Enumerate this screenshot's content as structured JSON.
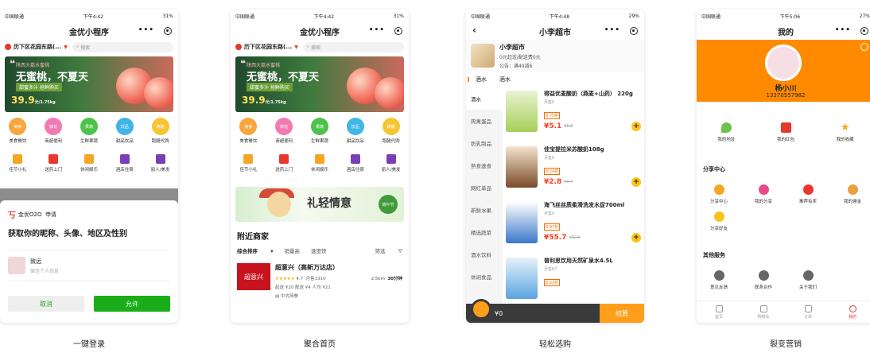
{
  "common": {
    "carrier": "中国联通",
    "app_title": "金优小程序",
    "location": "历下区花园东路(...",
    "search_placeholder": "搜索"
  },
  "phone1": {
    "time": "下午4:42",
    "battery": "31%",
    "banner": {
      "tag": "陕西大荔水蜜桃",
      "headline": "无蜜桃，不夏天",
      "sub": "甜蜜多汁 抢鲜购买",
      "price": "39.9",
      "unit": "元/1.75kg"
    },
    "categories": [
      {
        "label": "美食餐饮",
        "badge": "美食",
        "color": "#f8a63d"
      },
      {
        "label": "商超便利",
        "badge": "鲜花",
        "color": "#f27ab2"
      },
      {
        "label": "生鲜果蔬",
        "badge": "果蔬",
        "color": "#4cc24a"
      },
      {
        "label": "甜品饮品",
        "badge": "饮品",
        "color": "#3fb5e8"
      },
      {
        "label": "跑腿代购",
        "badge": "跑腿",
        "color": "#f7c531"
      },
      {
        "label": "佳节小礼",
        "color": "#f5a623"
      },
      {
        "label": "送药上门",
        "color": "#e8372c"
      },
      {
        "label": "休闲娱乐",
        "color": "#f5a623"
      },
      {
        "label": "酒店住宿",
        "color": "#7b3fb5"
      },
      {
        "label": "丽人/美发",
        "color": "#7b3fb5"
      }
    ],
    "auth": {
      "app_name": "金优O2O",
      "action": "申请",
      "title": "获取你的昵称、头像、地区及性别",
      "user_name": "致远",
      "user_sub": "微信个人信息",
      "deny": "取消",
      "allow": "允许"
    },
    "caption": "一键登录"
  },
  "phone2": {
    "time": "下午4:42",
    "battery": "31%",
    "promo": {
      "text": "礼轻情意",
      "stamp": "端午节"
    },
    "nearby_title": "附近商家",
    "filters": [
      "综合排序",
      "销量高",
      "速度快",
      "筛选"
    ],
    "store": {
      "logo_text": "超意兴",
      "name": "超意兴（高新万达店）",
      "rating": "4.7",
      "monthly": "月售1310",
      "distance": "2.5km",
      "time": "30分钟",
      "delivery": "起送 ¥20   配送 ¥4   人均 ¥21",
      "cuisine": "中式简餐"
    },
    "caption": "聚合首页"
  },
  "phone3": {
    "time": "下午4:48",
    "battery": "29%",
    "title": "小李超市",
    "shop": {
      "name": "小李超市",
      "fee": "0元起送/配送费0元",
      "notice": "公告：满49减6"
    },
    "tabs": [
      "酒水",
      "酒水"
    ],
    "side_menu": [
      "酒水",
      "肉禽蛋品",
      "奶乳制品",
      "熟食速食",
      "网红单品",
      "新鲜水果",
      "精选蔬菜",
      "酒水饮料",
      "休闲食品"
    ],
    "products": [
      {
        "name": "得益优麦酸奶（燕麦+山药） 220g",
        "monthly": "月售0",
        "tag": "8.75折",
        "price": "¥5.1",
        "old": "¥5.8"
      },
      {
        "name": "佳宝提拉米苏酸奶108g",
        "monthly": "月售0",
        "tag": "8.24折",
        "price": "¥2.8",
        "old": "¥3.4"
      },
      {
        "name": "海飞丝丝质柔滑洗发水促700ml",
        "monthly": "月售0",
        "tag": "8.97折",
        "price": "¥55.7",
        "old": "¥62.0"
      },
      {
        "name": "普利思饮用天然矿泉水4.5L",
        "monthly": "月售67",
        "tag": "8.33折",
        "price": "",
        "old": ""
      }
    ],
    "cart_total": "¥0",
    "checkout": "结算",
    "caption": "轻松选购"
  },
  "phone4": {
    "time": "下午5:06",
    "battery": "27%",
    "title": "我的",
    "name": "杨小川",
    "phone": "13370557982",
    "top_items": [
      {
        "label": "我的地址",
        "color": "#6cc24a"
      },
      {
        "label": "我的红包",
        "color": "#e8372c"
      },
      {
        "label": "我的收藏",
        "color": "#f5a623"
      }
    ],
    "share_title": "分享中心",
    "share_items": [
      {
        "label": "分享中心",
        "color": "#f5a623"
      },
      {
        "label": "我的分享",
        "color": "#e84a8a"
      },
      {
        "label": "推荐有奖",
        "color": "#e8372c"
      },
      {
        "label": "我的佣金",
        "color": "#e8a23d"
      },
      {
        "label": "分享好友",
        "color": "#f5c518"
      }
    ],
    "service_title": "其他服务",
    "service_items": [
      {
        "label": "意见反馈",
        "color": "#666"
      },
      {
        "label": "联系合作",
        "color": "#666"
      },
      {
        "label": "关于我们",
        "color": "#666"
      }
    ],
    "tabbar": [
      "首页",
      "购物车",
      "订单",
      "我的"
    ],
    "caption": "裂变营销"
  }
}
